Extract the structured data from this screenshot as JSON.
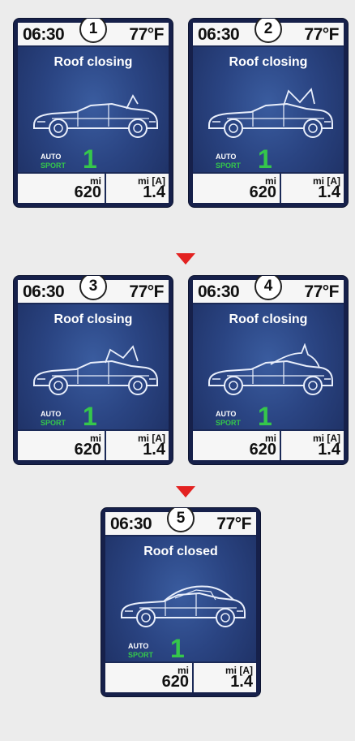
{
  "colors": {
    "arrow": "#e32221",
    "accent_green": "#35c74b",
    "panel_bg": "#2a4482"
  },
  "panels": [
    {
      "step": "1",
      "time": "06:30",
      "temp": "77°F",
      "status": "Roof closing",
      "mode_top": "AUTO",
      "mode_bottom": "SPORT",
      "gear": "1",
      "odo_unit": "mi",
      "odo_value": "620",
      "trip_unit": "mi [A]",
      "trip_value": "1.4"
    },
    {
      "step": "2",
      "time": "06:30",
      "temp": "77°F",
      "status": "Roof closing",
      "mode_top": "AUTO",
      "mode_bottom": "SPORT",
      "gear": "1",
      "odo_unit": "mi",
      "odo_value": "620",
      "trip_unit": "mi [A]",
      "trip_value": "1.4"
    },
    {
      "step": "3",
      "time": "06:30",
      "temp": "77°F",
      "status": "Roof closing",
      "mode_top": "AUTO",
      "mode_bottom": "SPORT",
      "gear": "1",
      "odo_unit": "mi",
      "odo_value": "620",
      "trip_unit": "mi [A]",
      "trip_value": "1.4"
    },
    {
      "step": "4",
      "time": "06:30",
      "temp": "77°F",
      "status": "Roof closing",
      "mode_top": "AUTO",
      "mode_bottom": "SPORT",
      "gear": "1",
      "odo_unit": "mi",
      "odo_value": "620",
      "trip_unit": "mi [A]",
      "trip_value": "1.4"
    },
    {
      "step": "5",
      "time": "06:30",
      "temp": "77°F",
      "status": "Roof closed",
      "mode_top": "AUTO",
      "mode_bottom": "SPORT",
      "gear": "1",
      "odo_unit": "mi",
      "odo_value": "620",
      "trip_unit": "mi [A]",
      "trip_value": "1.4"
    }
  ],
  "icons": {
    "car": "convertible-car-icon",
    "arrow": "down-arrow-icon"
  }
}
